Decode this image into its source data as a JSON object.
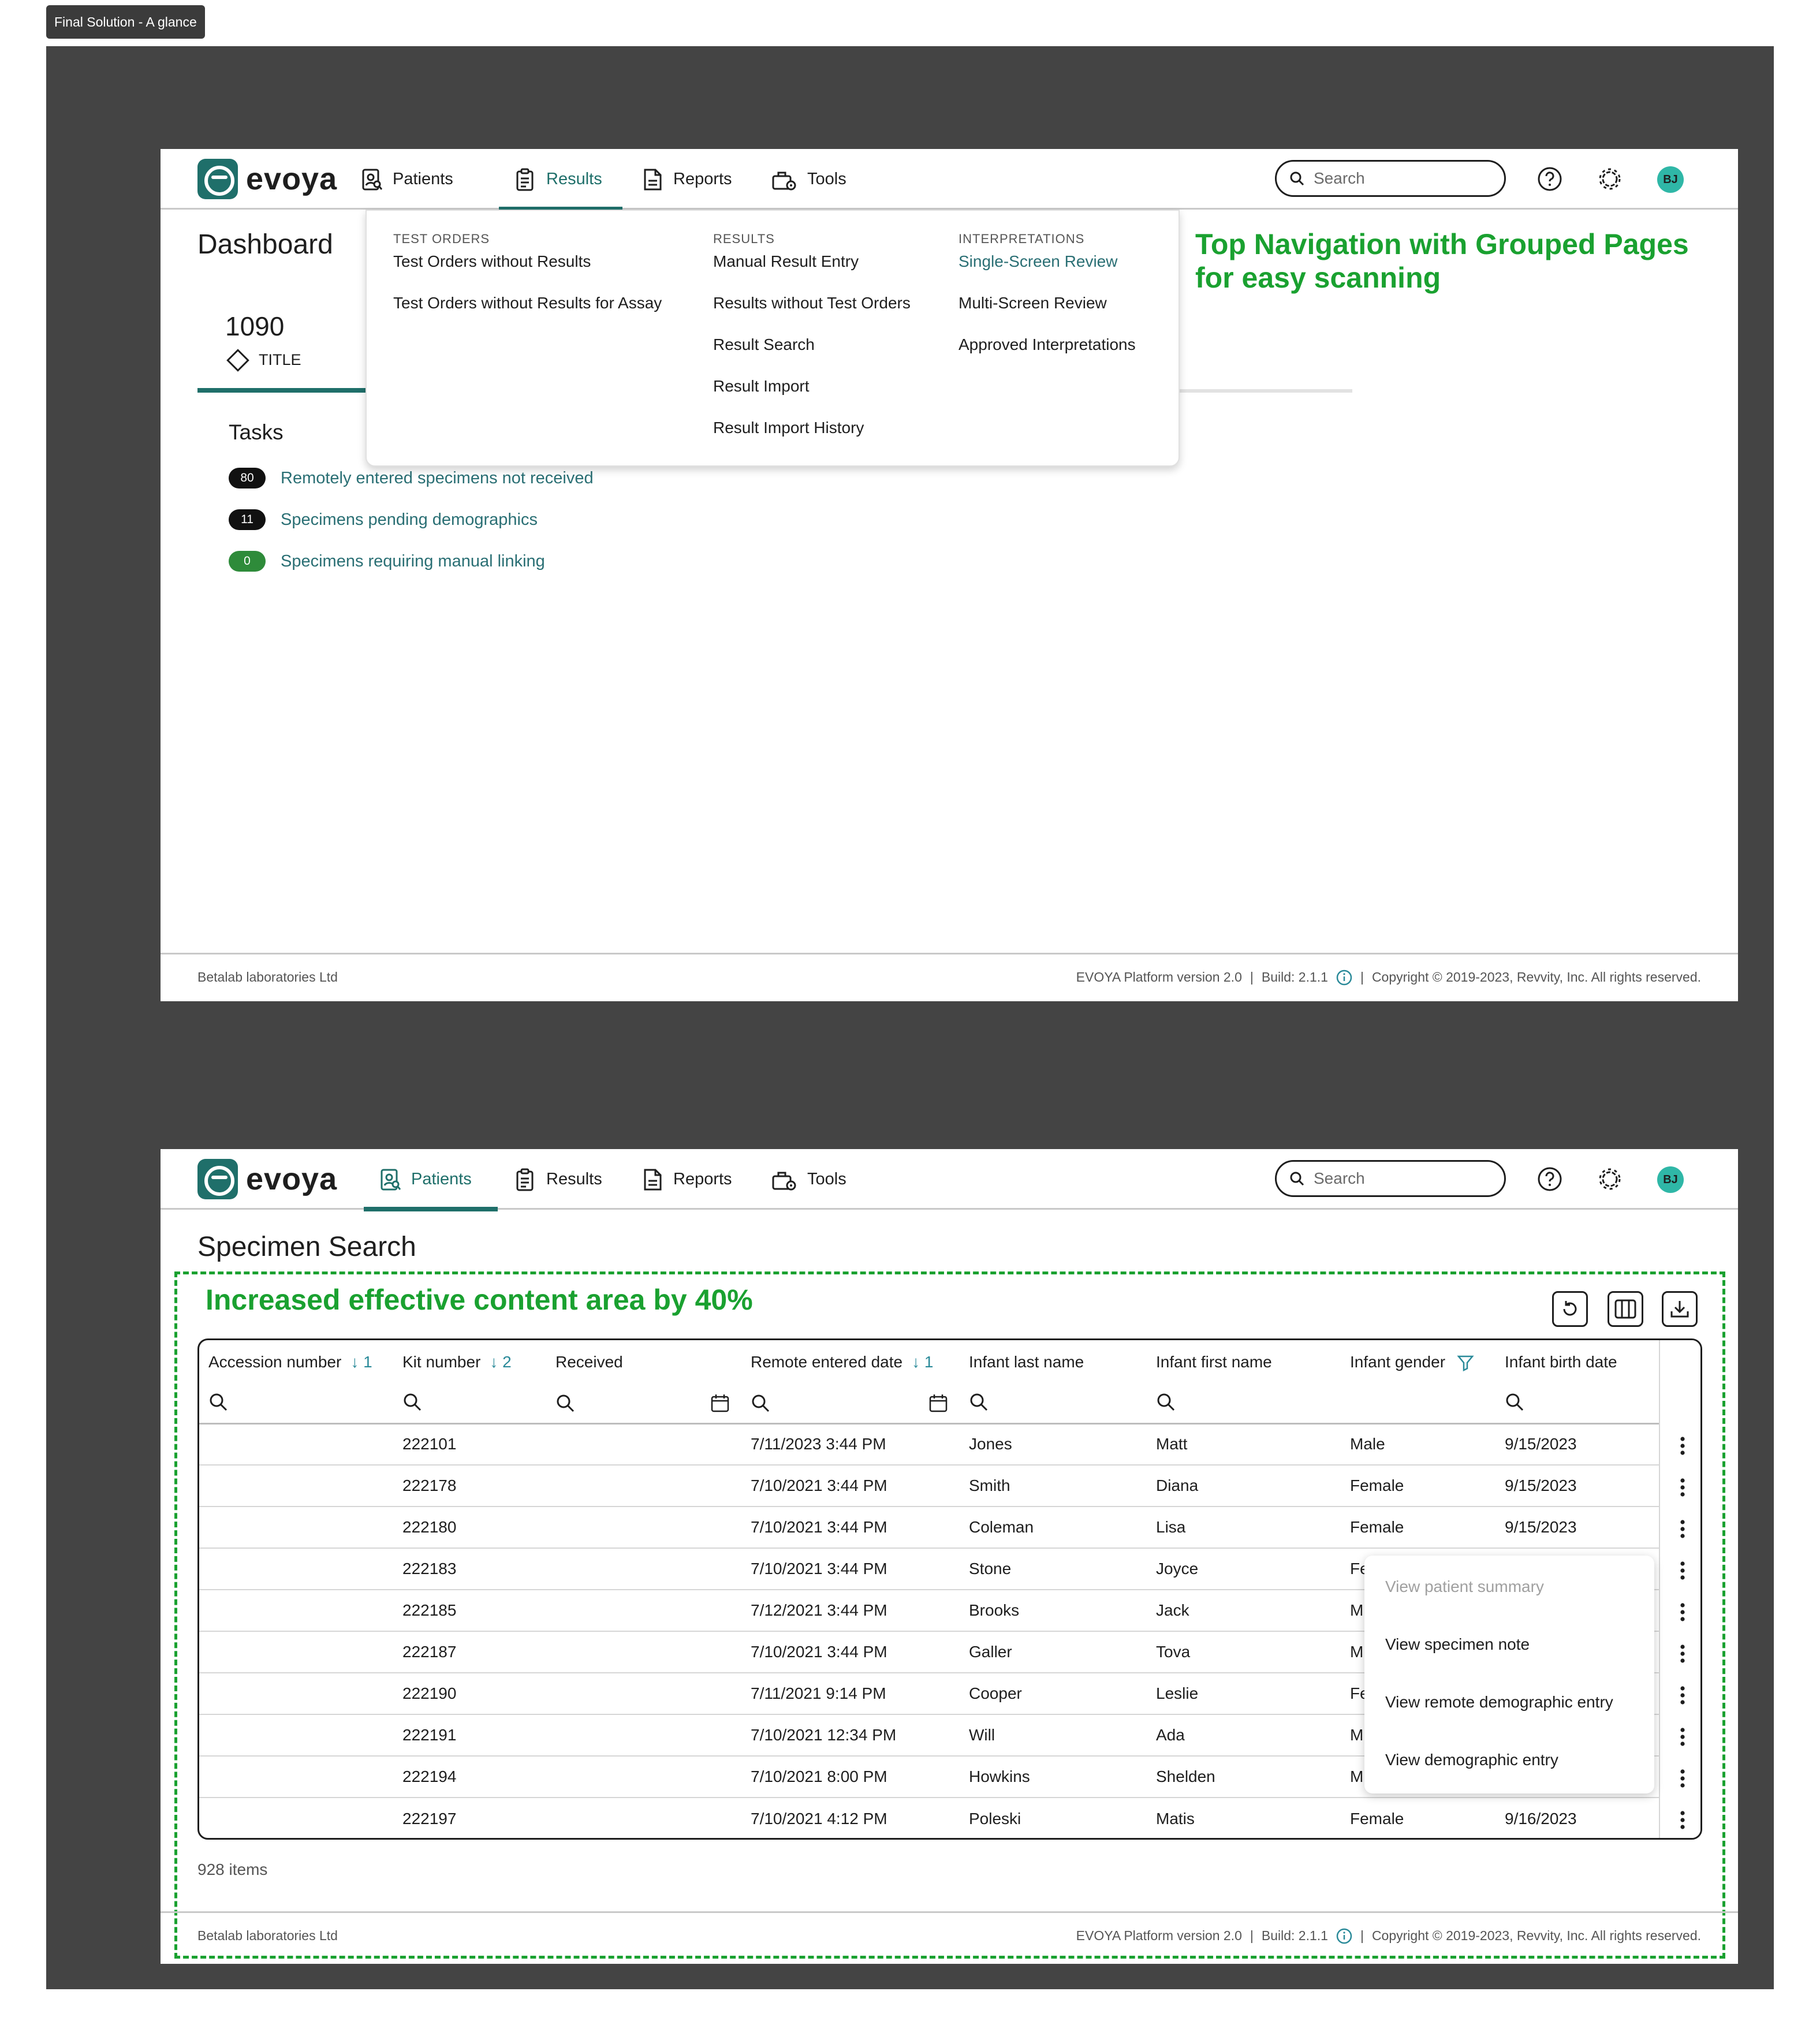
{
  "frame_label": "Final Solution - A glance",
  "app": {
    "logo_text": "evoya",
    "nav": [
      {
        "label": "Patients",
        "icon": "patients-icon"
      },
      {
        "label": "Results",
        "icon": "results-icon"
      },
      {
        "label": "Reports",
        "icon": "reports-icon"
      },
      {
        "label": "Tools",
        "icon": "tools-icon"
      }
    ],
    "search_placeholder": "Search",
    "user_initials": "BJ",
    "accent_color": "#1f6f6a",
    "link_color": "#2a6f74"
  },
  "screen1": {
    "active_nav": "Results",
    "page_title": "Dashboard",
    "kpi": {
      "value": "1090",
      "label": "TITLE"
    },
    "tasks_title": "Tasks",
    "tasks": [
      {
        "count": "80",
        "label": "Remotely entered specimens not received",
        "badge": "dark"
      },
      {
        "count": "11",
        "label": "Specimens pending demographics",
        "badge": "dark"
      },
      {
        "count": "0",
        "label": "Specimens requiring manual linking",
        "badge": "green"
      }
    ],
    "dropdown": {
      "test_orders": {
        "heading": "TEST ORDERS",
        "items": [
          "Test Orders without Results",
          "Test Orders without Results for Assay"
        ]
      },
      "results": {
        "heading": "RESULTS",
        "items": [
          "Manual Result Entry",
          "Results without Test Orders",
          "Result Search",
          "Result Import",
          "Result Import History"
        ]
      },
      "interpretations": {
        "heading": "INTERPRETATIONS",
        "items": [
          "Single-Screen Review",
          "Multi-Screen Review",
          "Approved Interpretations"
        ],
        "highlighted": "Single-Screen Review"
      }
    },
    "callout_line1": "Top Navigation with Grouped Pages",
    "callout_line2": "for easy scanning"
  },
  "footer": {
    "org": "Betalab laboratories Ltd",
    "version": "EVOYA Platform version 2.0",
    "sep1": "|",
    "build": "Build: 2.1.1",
    "sep2": "|",
    "copyright": "Copyright © 2019-2023, Revvity, Inc. All rights reserved."
  },
  "screen2": {
    "active_nav": "Patients",
    "page_title": "Specimen Search",
    "callout": "Increased effective content area by 40%",
    "toolbar": [
      "reset-icon",
      "columns-icon",
      "download-icon"
    ],
    "columns": [
      {
        "label": "Accession number",
        "sort": "↓ 1"
      },
      {
        "label": "Kit number",
        "sort": "↓ 2"
      },
      {
        "label": "Received",
        "sort": ""
      },
      {
        "label": "Remote entered date",
        "sort": "↓ 1"
      },
      {
        "label": "Infant last name",
        "sort": ""
      },
      {
        "label": "Infant first name",
        "sort": ""
      },
      {
        "label": "Infant gender",
        "sort": ""
      },
      {
        "label": "Infant birth date",
        "sort": ""
      }
    ],
    "rows": [
      {
        "accession": "",
        "kit": "222101",
        "received": "",
        "remote_date": "7/11/2023 3:44 PM",
        "last": "Jones",
        "first": "Matt",
        "gender": "Male",
        "birth": "9/15/2023"
      },
      {
        "accession": "",
        "kit": "222178",
        "received": "",
        "remote_date": "7/10/2021 3:44 PM",
        "last": "Smith",
        "first": "Diana",
        "gender": "Female",
        "birth": "9/15/2023"
      },
      {
        "accession": "",
        "kit": "222180",
        "received": "",
        "remote_date": "7/10/2021 3:44 PM",
        "last": "Coleman",
        "first": "Lisa",
        "gender": "Female",
        "birth": "9/15/2023"
      },
      {
        "accession": "",
        "kit": "222183",
        "received": "",
        "remote_date": "7/10/2021 3:44 PM",
        "last": "Stone",
        "first": "Joyce",
        "gender": "Fe",
        "birth": ""
      },
      {
        "accession": "",
        "kit": "222185",
        "received": "",
        "remote_date": "7/12/2021 3:44 PM",
        "last": "Brooks",
        "first": "Jack",
        "gender": "M",
        "birth": ""
      },
      {
        "accession": "",
        "kit": "222187",
        "received": "",
        "remote_date": "7/10/2021 3:44 PM",
        "last": "Galler",
        "first": "Tova",
        "gender": "M",
        "birth": ""
      },
      {
        "accession": "",
        "kit": "222190",
        "received": "",
        "remote_date": "7/11/2021 9:14 PM",
        "last": "Cooper",
        "first": "Leslie",
        "gender": "Fe",
        "birth": ""
      },
      {
        "accession": "",
        "kit": "222191",
        "received": "",
        "remote_date": "7/10/2021 12:34 PM",
        "last": "Will",
        "first": "Ada",
        "gender": "M",
        "birth": ""
      },
      {
        "accession": "",
        "kit": "222194",
        "received": "",
        "remote_date": "7/10/2021 8:00 PM",
        "last": "Howkins",
        "first": "Shelden",
        "gender": "M",
        "birth": ""
      },
      {
        "accession": "",
        "kit": "222197",
        "received": "",
        "remote_date": "7/10/2021 4:12 PM",
        "last": "Poleski",
        "first": "Matis",
        "gender": "Female",
        "birth": "9/16/2023"
      }
    ],
    "context_menu": [
      {
        "label": "View patient summary",
        "disabled": true
      },
      {
        "label": "View specimen note",
        "disabled": false
      },
      {
        "label": "View remote demographic entry",
        "disabled": false
      },
      {
        "label": "View demographic entry",
        "disabled": false
      }
    ],
    "items_count": "928 items"
  },
  "callout_color": "#1aa130"
}
